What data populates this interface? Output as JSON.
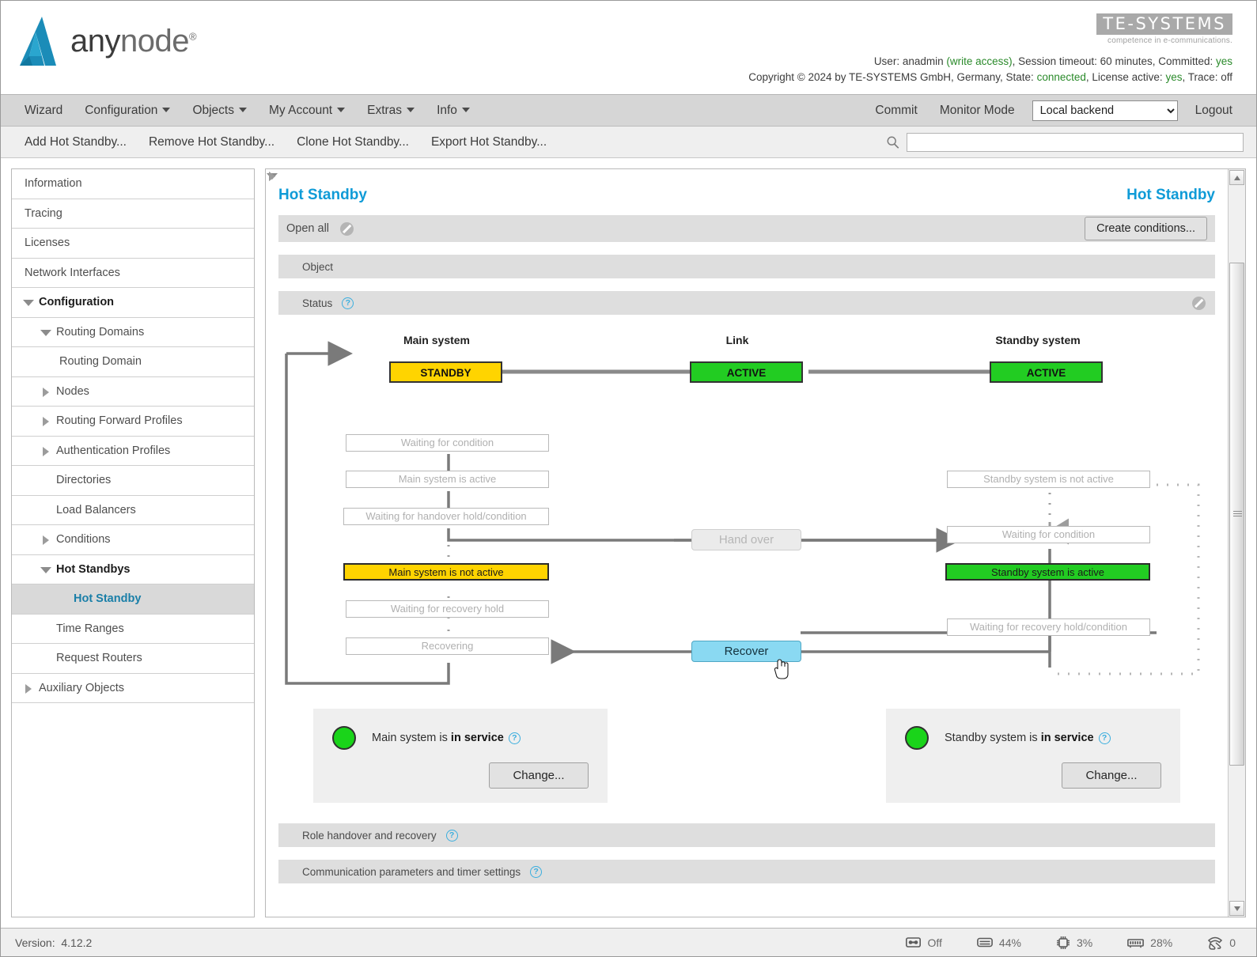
{
  "header": {
    "logo_text_dark": "any",
    "logo_text_light": "node",
    "logo_registered": "®",
    "brand_name": "TE-SYSTEMS",
    "brand_tagline": "competence in e-communications.",
    "info_line1_pre": "User: anadmin ",
    "info_line1_access": "(write access)",
    "info_line1_post": ", Session timeout: 60 minutes, Committed: ",
    "info_line1_committed": "yes",
    "info_line2_pre": "Copyright © 2024 by TE-SYSTEMS GmbH, Germany, State: ",
    "info_line2_state": "connected",
    "info_line2_mid": ", License active: ",
    "info_line2_license": "yes",
    "info_line2_post": ", Trace: off"
  },
  "menubar": {
    "items": [
      {
        "label": "Wizard",
        "has_caret": false
      },
      {
        "label": "Configuration",
        "has_caret": true
      },
      {
        "label": "Objects",
        "has_caret": true
      },
      {
        "label": "My Account",
        "has_caret": true
      },
      {
        "label": "Extras",
        "has_caret": true
      },
      {
        "label": "Info",
        "has_caret": true
      }
    ],
    "right_items": [
      {
        "label": "Commit"
      },
      {
        "label": "Monitor Mode"
      }
    ],
    "backend_selected": "Local backend",
    "backend_options": [
      "Local backend"
    ],
    "logout": "Logout"
  },
  "actionbar": {
    "items": [
      "Add Hot Standby...",
      "Remove Hot Standby...",
      "Clone Hot Standby...",
      "Export Hot Standby..."
    ],
    "search_value": "",
    "search_placeholder": ""
  },
  "sidebar": {
    "items": [
      {
        "label": "Information",
        "level": 0,
        "twisty": "none",
        "selected": false,
        "bold": false
      },
      {
        "label": "Tracing",
        "level": 0,
        "twisty": "none",
        "selected": false,
        "bold": false
      },
      {
        "label": "Licenses",
        "level": 0,
        "twisty": "none",
        "selected": false,
        "bold": false
      },
      {
        "label": "Network Interfaces",
        "level": 0,
        "twisty": "none",
        "selected": false,
        "bold": false
      },
      {
        "label": "Configuration",
        "level": 0,
        "twisty": "down",
        "selected": false,
        "bold": true
      },
      {
        "label": "Routing Domains",
        "level": 1,
        "twisty": "down",
        "selected": false,
        "bold": false
      },
      {
        "label": "Routing Domain",
        "level": 2,
        "twisty": "none",
        "selected": false,
        "bold": false
      },
      {
        "label": "Nodes",
        "level": 1,
        "twisty": "right",
        "selected": false,
        "bold": false
      },
      {
        "label": "Routing Forward Profiles",
        "level": 1,
        "twisty": "right",
        "selected": false,
        "bold": false
      },
      {
        "label": "Authentication Profiles",
        "level": 1,
        "twisty": "right",
        "selected": false,
        "bold": false
      },
      {
        "label": "Directories",
        "level": 1,
        "twisty": "none",
        "selected": false,
        "bold": false
      },
      {
        "label": "Load Balancers",
        "level": 1,
        "twisty": "none",
        "selected": false,
        "bold": false
      },
      {
        "label": "Conditions",
        "level": 1,
        "twisty": "right",
        "selected": false,
        "bold": false
      },
      {
        "label": "Hot Standbys",
        "level": 1,
        "twisty": "down",
        "selected": false,
        "bold": true
      },
      {
        "label": "Hot Standby",
        "level": 2,
        "twisty": "none",
        "selected": true,
        "bold": true
      },
      {
        "label": "Time Ranges",
        "level": 1,
        "twisty": "none",
        "selected": false,
        "bold": false
      },
      {
        "label": "Request Routers",
        "level": 1,
        "twisty": "none",
        "selected": false,
        "bold": false
      },
      {
        "label": "Auxiliary Objects",
        "level": 0,
        "twisty": "right",
        "selected": false,
        "bold": false
      }
    ]
  },
  "main": {
    "title_left": "Hot Standby",
    "title_right": "Hot Standby",
    "open_all_label": "Open all",
    "create_conditions_label": "Create conditions...",
    "sections": [
      {
        "label": "Object",
        "expanded": false,
        "help": false
      },
      {
        "label": "Status",
        "expanded": true,
        "help": true
      },
      {
        "label": "Role handover and recovery",
        "expanded": false,
        "help": true
      },
      {
        "label": "Communication parameters and timer settings",
        "expanded": false,
        "help": true
      }
    ],
    "help_glyph": "?"
  },
  "chart_data": {
    "type": "diagram",
    "title": "Hot Standby Status",
    "top_row": {
      "columns": [
        {
          "label": "Main system",
          "state": "STANDBY",
          "color": "#ffd400"
        },
        {
          "label": "Link",
          "state": "ACTIVE",
          "color": "#22cc22"
        },
        {
          "label": "Standby system",
          "state": "ACTIVE",
          "color": "#22cc22"
        }
      ]
    },
    "left_flow": [
      {
        "label": "Waiting for condition",
        "active": false
      },
      {
        "label": "Main system is active",
        "active": false
      },
      {
        "label": "Waiting for handover hold/condition",
        "active": false
      },
      {
        "label": "Main system is not active",
        "active": true,
        "highlight": "yellow"
      },
      {
        "label": "Waiting for recovery hold",
        "active": false
      },
      {
        "label": "Recovering",
        "active": false
      }
    ],
    "right_flow": [
      {
        "label": "Standby system is not active",
        "active": false
      },
      {
        "label": "Waiting for condition",
        "active": false
      },
      {
        "label": "Standby system is active",
        "active": true,
        "highlight": "green"
      },
      {
        "label": "Waiting for recovery hold/condition",
        "active": false
      }
    ],
    "actions": [
      {
        "label": "Hand over",
        "enabled": false
      },
      {
        "label": "Recover",
        "enabled": true,
        "hovered": true
      }
    ]
  },
  "services": {
    "main": {
      "text_pre": "Main system is ",
      "text_state": "in service",
      "led_color": "#1ad41a",
      "change_label": "Change..."
    },
    "standby": {
      "text_pre": "Standby system is ",
      "text_state": "in service",
      "led_color": "#1ad41a",
      "change_label": "Change..."
    }
  },
  "statusbar": {
    "version_label": "Version:",
    "version_value": "4.12.2",
    "metrics": [
      {
        "icon": "tape-icon",
        "value": "Off"
      },
      {
        "icon": "disk-icon",
        "value": "44%"
      },
      {
        "icon": "cpu-icon",
        "value": "3%"
      },
      {
        "icon": "memory-icon",
        "value": "28%"
      },
      {
        "icon": "calls-icon",
        "value": "0"
      }
    ]
  }
}
